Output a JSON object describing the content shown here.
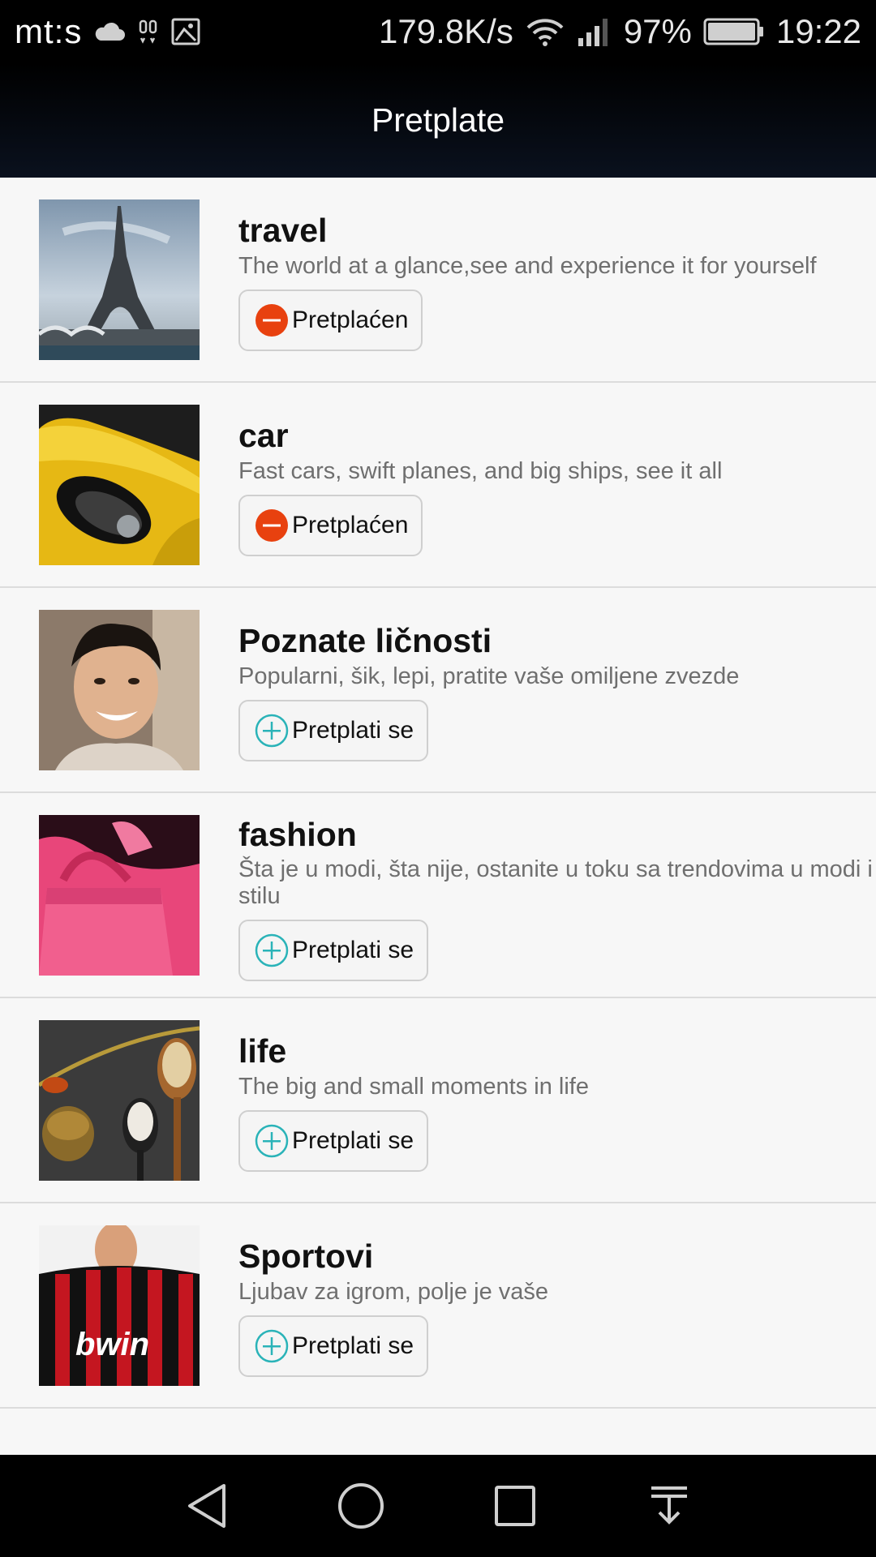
{
  "status_bar": {
    "carrier": "mt:s",
    "speed": "179.8K/s",
    "battery": "97%",
    "time": "19:22",
    "icons": [
      "cloud-icon",
      "vibrate-icon",
      "image-icon",
      "wifi-icon",
      "signal-icon",
      "battery-icon"
    ]
  },
  "header": {
    "title": "Pretplate"
  },
  "subscriptions": [
    {
      "title": "travel",
      "description": "The world at a glance,see and experience it for yourself",
      "button": "Pretplaćen",
      "subscribed": true,
      "image": "eiffel-tower-image"
    },
    {
      "title": "car",
      "description": "Fast cars, swift planes, and big ships, see it all",
      "button": "Pretplaćen",
      "subscribed": true,
      "image": "yellow-car-image"
    },
    {
      "title": "Poznate ličnosti",
      "description": "Popularni, šik, lepi, pratite vaše omiljene zvezde",
      "button": "Pretplati se",
      "subscribed": false,
      "image": "smiling-man-image"
    },
    {
      "title": "fashion",
      "description": "Šta je u modi, šta nije, ostanite u toku sa trendovima u modi i stilu",
      "button": "Pretplati se",
      "subscribed": false,
      "image": "pink-handbag-image"
    },
    {
      "title": "life",
      "description": "The big and small moments in life",
      "button": "Pretplati se",
      "subscribed": false,
      "image": "spices-spoons-image"
    },
    {
      "title": "Sportovi",
      "description": "Ljubav za igrom, polje je vaše",
      "button": "Pretplati se",
      "subscribed": false,
      "image": "football-jersey-image"
    }
  ],
  "colors": {
    "subscribed_accent": "#e8410f",
    "subscribe_accent": "#2ab3b8"
  },
  "nav_bar": [
    "back-icon",
    "home-icon",
    "recents-icon",
    "notification-pull-icon"
  ]
}
